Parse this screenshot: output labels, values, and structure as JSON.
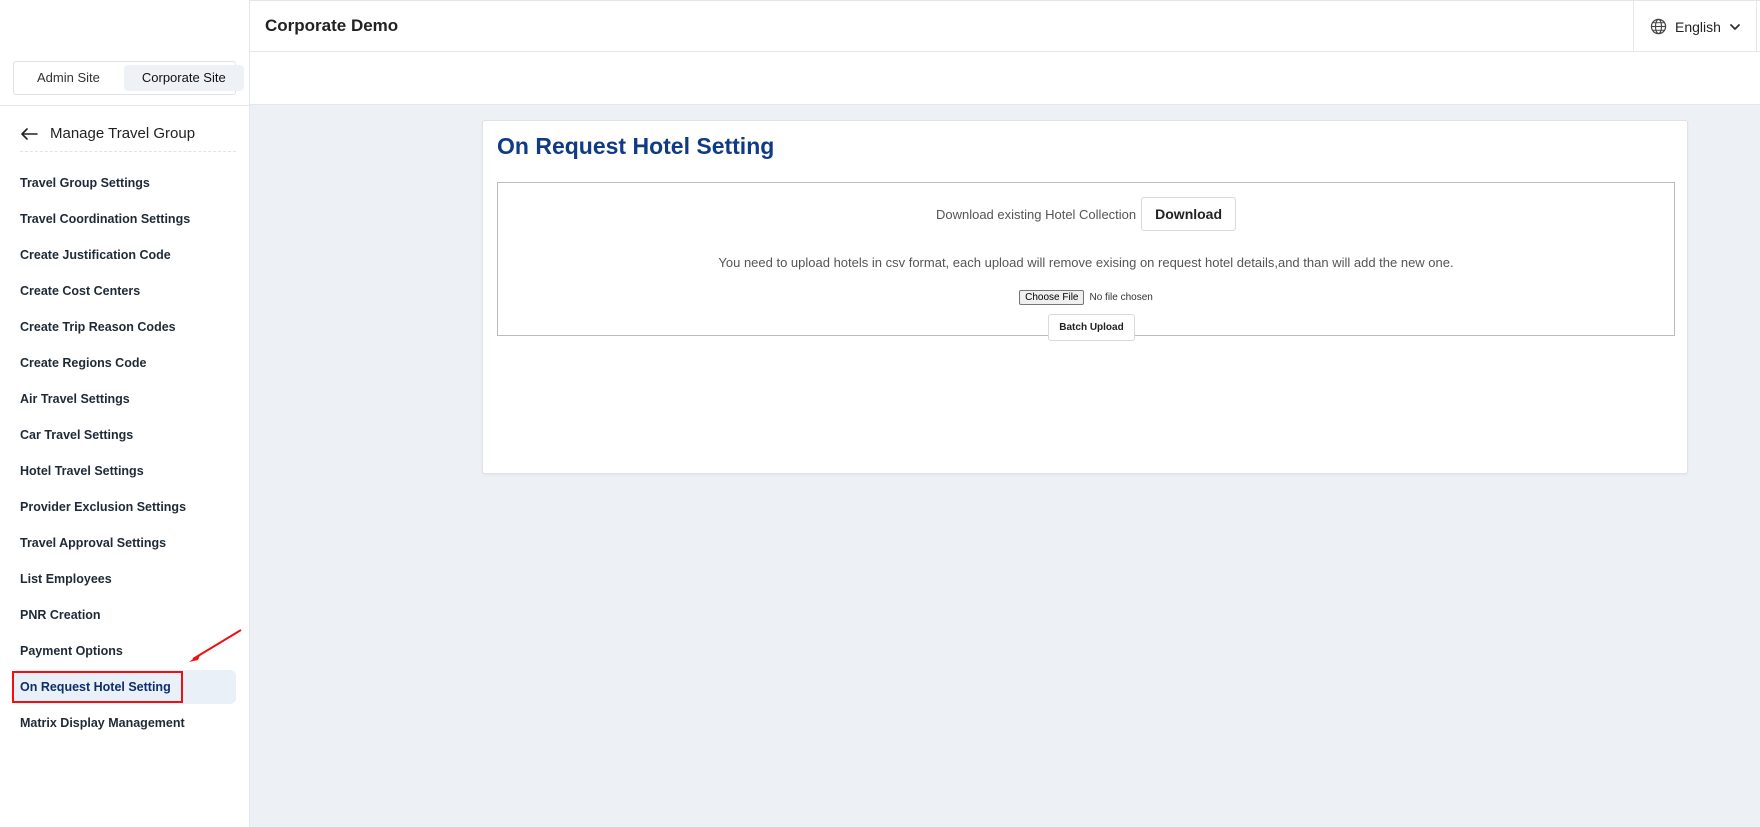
{
  "header": {
    "title": "Corporate Demo",
    "language": "English",
    "globe_icon": "globe-icon",
    "chevron_icon": "chevron-down-icon"
  },
  "site_switch": {
    "tabs": [
      {
        "label": "Admin Site",
        "active": false
      },
      {
        "label": "Corporate Site",
        "active": true
      }
    ]
  },
  "sidebar": {
    "back_title": "Manage Travel Group",
    "back_icon": "arrow-left-icon",
    "items": [
      {
        "label": "Travel Group Settings"
      },
      {
        "label": "Travel Coordination Settings"
      },
      {
        "label": "Create Justification Code"
      },
      {
        "label": "Create Cost Centers"
      },
      {
        "label": "Create Trip Reason Codes"
      },
      {
        "label": "Create Regions Code"
      },
      {
        "label": "Air Travel Settings"
      },
      {
        "label": "Car Travel Settings"
      },
      {
        "label": "Hotel Travel Settings"
      },
      {
        "label": "Provider Exclusion Settings"
      },
      {
        "label": "Travel Approval Settings"
      },
      {
        "label": "List Employees"
      },
      {
        "label": "PNR Creation"
      },
      {
        "label": "Payment Options"
      },
      {
        "label": "On Request Hotel Setting",
        "active": true
      },
      {
        "label": "Matrix Display Management"
      }
    ]
  },
  "main": {
    "title": "On Request Hotel Setting",
    "download_text": "Download existing Hotel Collection",
    "download_button": "Download",
    "info_text": "You need to upload hotels in csv format, each upload will remove exising on request hotel details,and than will add the new one.",
    "choose_file_button": "Choose File",
    "file_status": "No file chosen",
    "batch_upload_button": "Batch Upload"
  },
  "colors": {
    "accent": "#0f3b85",
    "highlight_box": "#ee1111",
    "active_bg": "#e9f0f8",
    "page_bg": "#edf1f5"
  }
}
